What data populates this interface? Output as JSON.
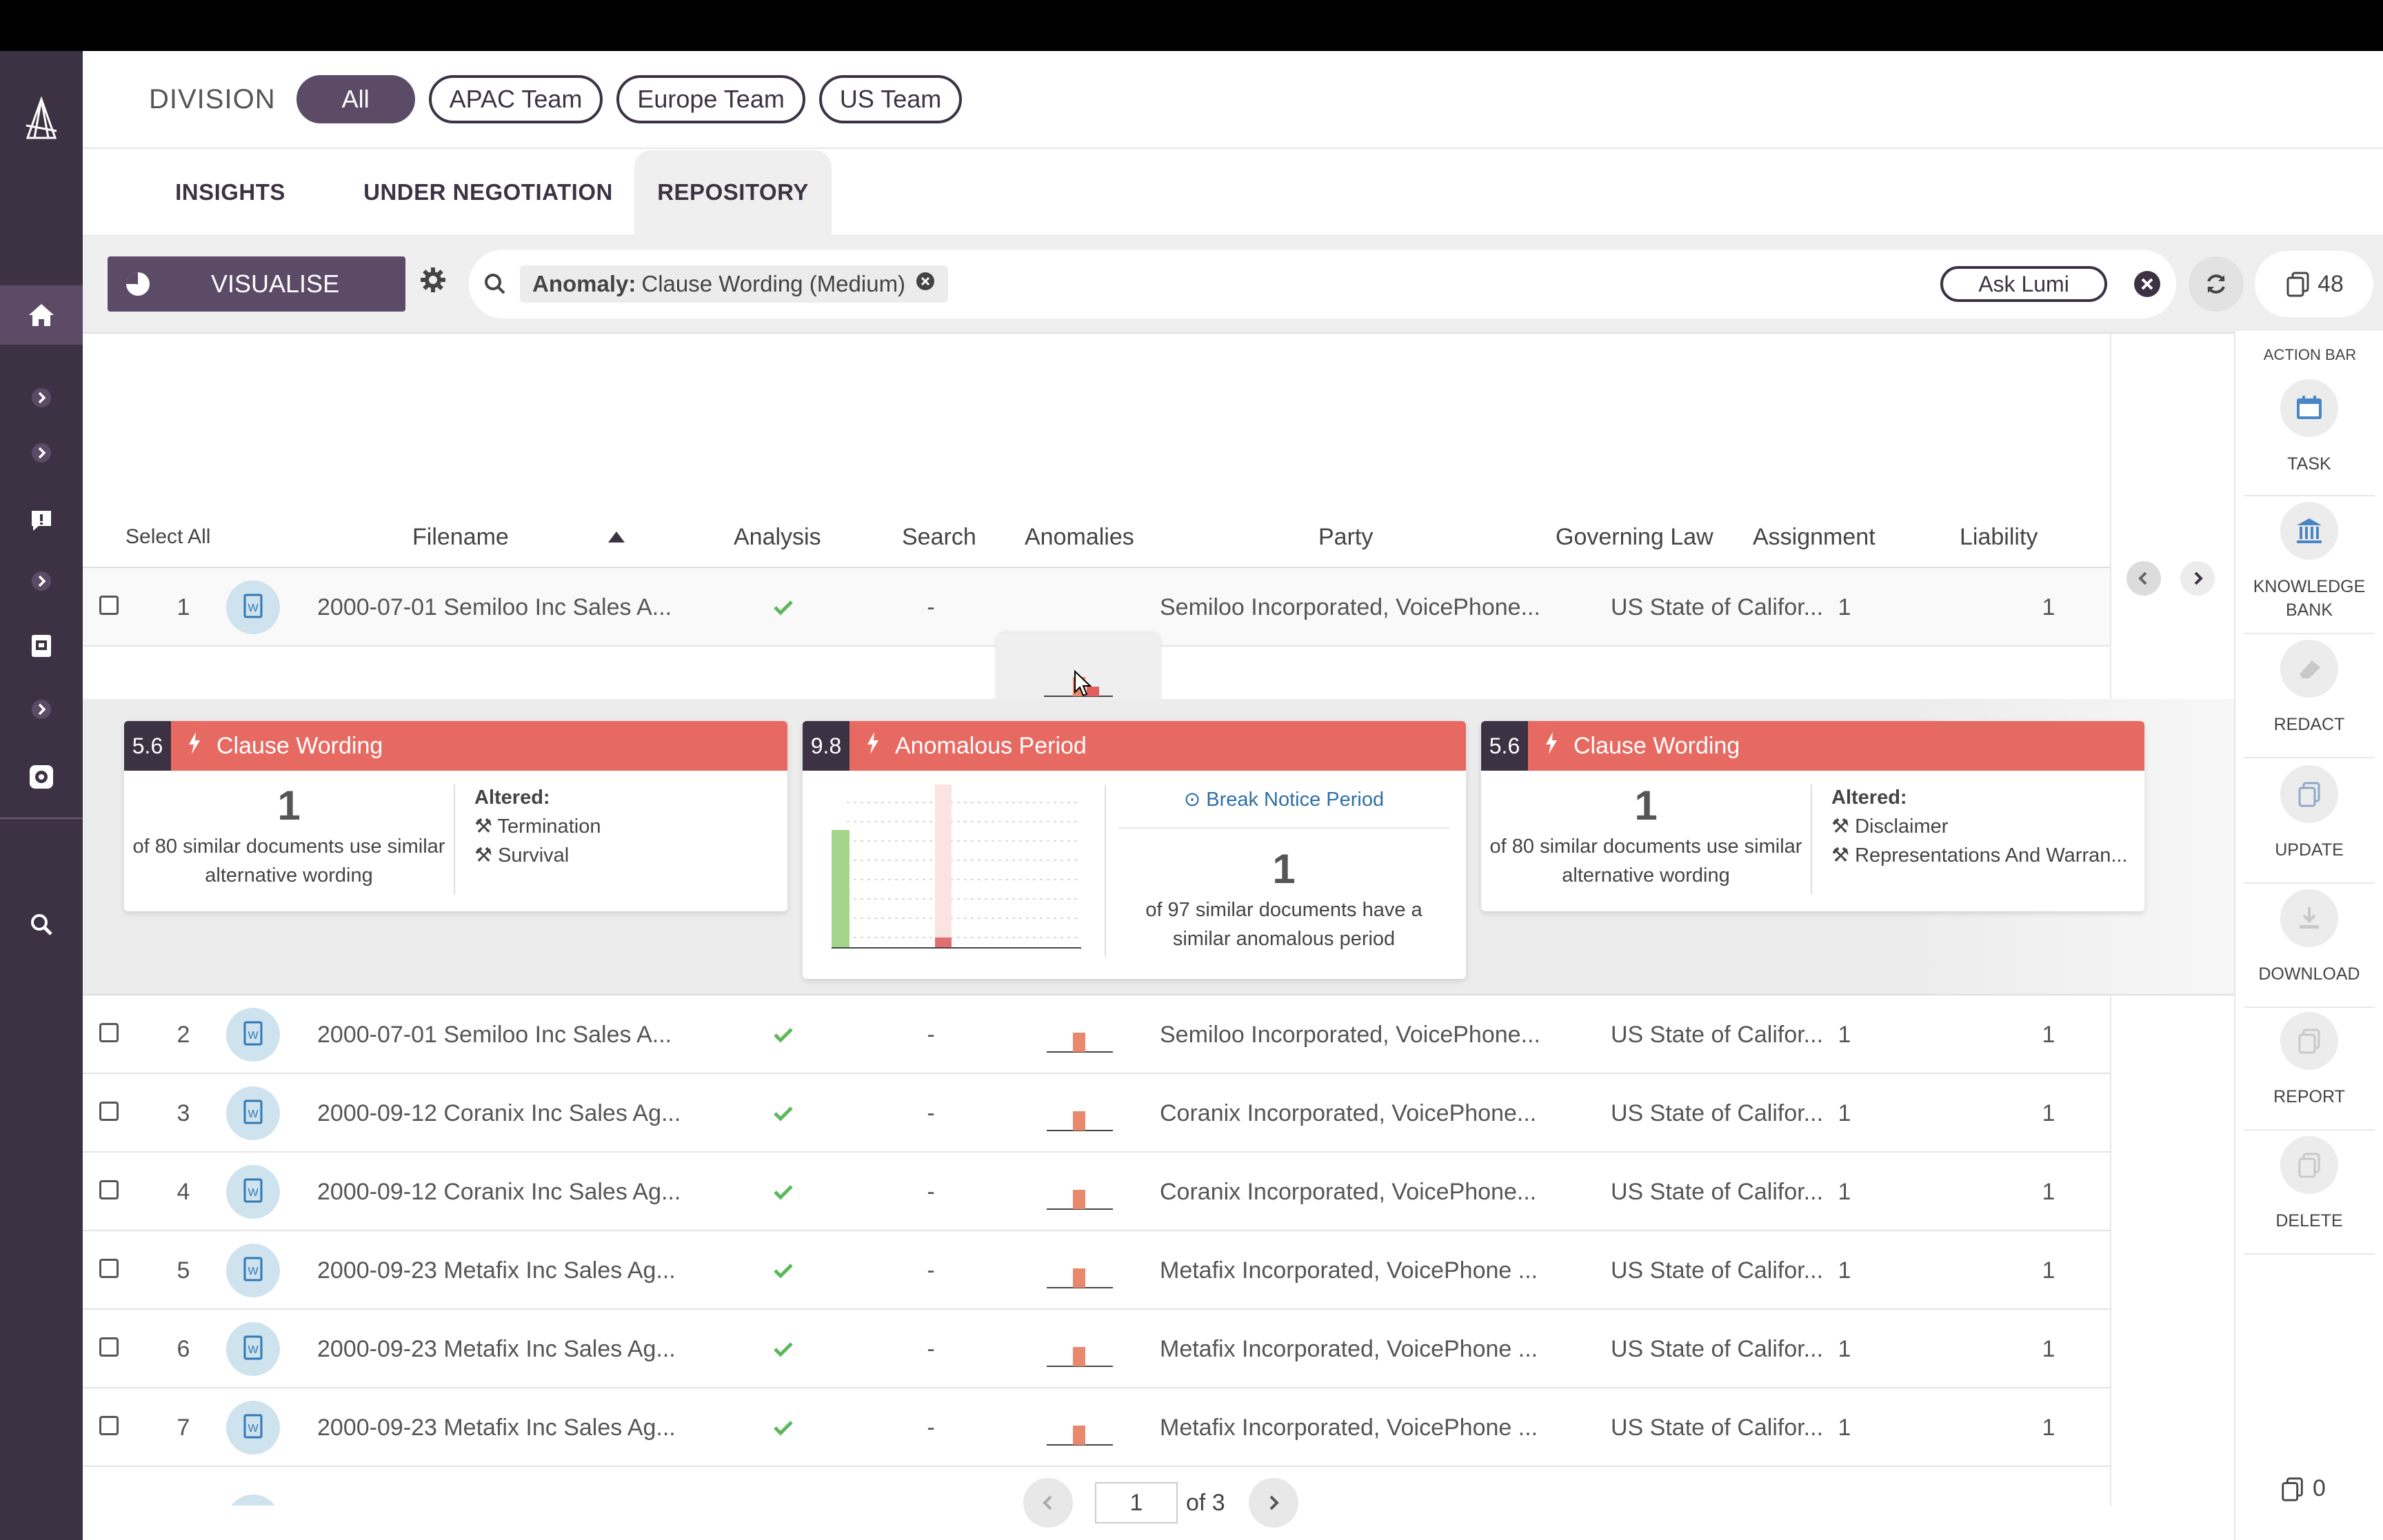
{
  "division": {
    "label": "DIVISION",
    "filters": [
      "All",
      "APAC Team",
      "Europe Team",
      "US Team"
    ]
  },
  "tabs": [
    "INSIGHTS",
    "UNDER NEGOTIATION",
    "REPOSITORY"
  ],
  "toolbar": {
    "visualise_label": "VISUALISE",
    "chip_key": "Anomaly:",
    "chip_value": "Clause Wording (Medium)",
    "ask_label": "Ask Lumi",
    "doc_count": "48"
  },
  "table": {
    "select_all": "Select All",
    "columns": [
      "Filename",
      "Analysis",
      "Search",
      "Anomalies",
      "Party",
      "Governing Law",
      "Assignment",
      "Liability"
    ],
    "rows": [
      {
        "num": "1",
        "filename": "2000-07-01 Semiloo Inc Sales A...",
        "search": "-",
        "party": "Semiloo Incorporated, VoicePhone...",
        "law": "US State of Califor...",
        "assignment": "1",
        "liability": "1"
      },
      {
        "num": "2",
        "filename": "2000-07-01 Semiloo Inc Sales A...",
        "search": "-",
        "party": "Semiloo Incorporated, VoicePhone...",
        "law": "US State of Califor...",
        "assignment": "1",
        "liability": "1"
      },
      {
        "num": "3",
        "filename": "2000-09-12 Coranix Inc Sales Ag...",
        "search": "-",
        "party": "Coranix Incorporated, VoicePhone...",
        "law": "US State of Califor...",
        "assignment": "1",
        "liability": "1"
      },
      {
        "num": "4",
        "filename": "2000-09-12 Coranix Inc Sales Ag...",
        "search": "-",
        "party": "Coranix Incorporated, VoicePhone...",
        "law": "US State of Califor...",
        "assignment": "1",
        "liability": "1"
      },
      {
        "num": "5",
        "filename": "2000-09-23 Metafix Inc Sales Ag...",
        "search": "-",
        "party": "Metafix Incorporated, VoicePhone ...",
        "law": "US State of Califor...",
        "assignment": "1",
        "liability": "1"
      },
      {
        "num": "6",
        "filename": "2000-09-23 Metafix Inc Sales Ag...",
        "search": "-",
        "party": "Metafix Incorporated, VoicePhone ...",
        "law": "US State of Califor...",
        "assignment": "1",
        "liability": "1"
      },
      {
        "num": "7",
        "filename": "2000-09-23 Metafix Inc Sales Ag...",
        "search": "-",
        "party": "Metafix Incorporated, VoicePhone ...",
        "law": "US State of Califor...",
        "assignment": "1",
        "liability": "1"
      }
    ]
  },
  "cards": [
    {
      "score": "5.6",
      "title": "Clause Wording",
      "count": "1",
      "desc1": "of 80 similar documents use similar",
      "desc2": "alternative wording",
      "altered_label": "Altered:",
      "altered": [
        "Termination",
        "Survival"
      ]
    },
    {
      "score": "9.8",
      "title": "Anomalous Period",
      "link": "Break Notice Period",
      "count": "1",
      "desc1": "of 97 similar documents have a",
      "desc2": "similar anomalous period"
    },
    {
      "score": "5.6",
      "title": "Clause Wording",
      "count": "1",
      "desc1": "of 80 similar documents use similar",
      "desc2": "alternative wording",
      "altered_label": "Altered:",
      "altered": [
        "Disclaimer",
        "Representations And Warran..."
      ]
    }
  ],
  "pager": {
    "page": "1",
    "of": "of 3"
  },
  "actionbar": {
    "title": "ACTION BAR",
    "items": [
      {
        "label1": "TASK",
        "label2": "",
        "icon": "task-icon"
      },
      {
        "label1": "KNOWLEDGE",
        "label2": "BANK",
        "icon": "bank-icon"
      },
      {
        "label1": "REDACT",
        "label2": "",
        "icon": "eraser-icon"
      },
      {
        "label1": "UPDATE",
        "label2": "",
        "icon": "copy-icon"
      },
      {
        "label1": "DOWNLOAD",
        "label2": "",
        "icon": "download-icon"
      },
      {
        "label1": "REPORT",
        "label2": "",
        "icon": "report-icon"
      },
      {
        "label1": "DELETE",
        "label2": "",
        "icon": "delete-icon"
      }
    ],
    "selected_count": "0"
  },
  "colors": {
    "sidebar": "#3d3244",
    "accent": "#5b4b66",
    "alert": "#e76a62",
    "check": "#5cb85c",
    "bar": "#e8896d"
  }
}
